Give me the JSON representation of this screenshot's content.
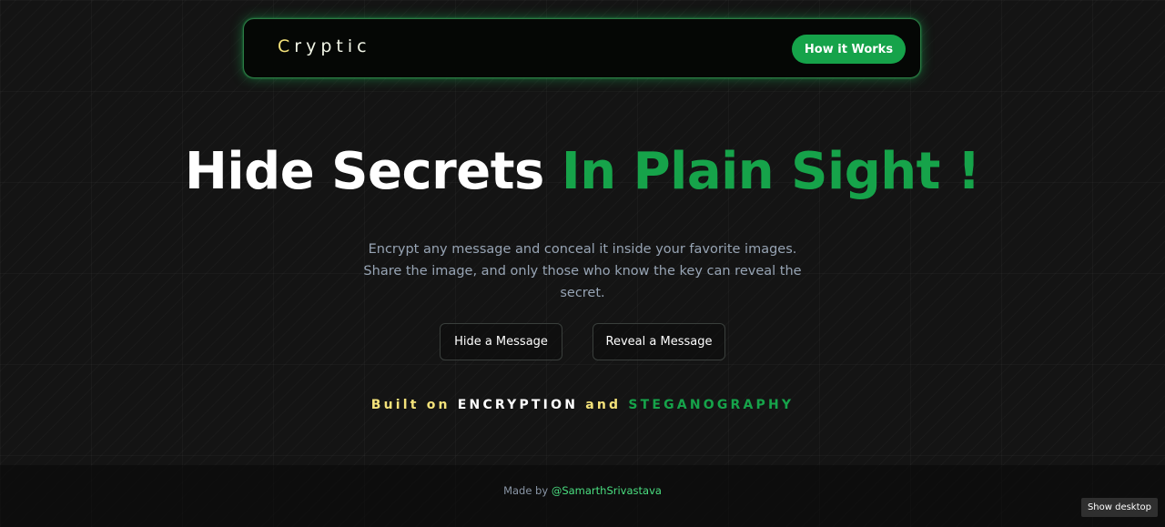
{
  "navbar": {
    "brand_first": "C",
    "brand_rest": "ryptic",
    "how_it_works_label": "How it Works"
  },
  "hero": {
    "headline_white": "Hide Secrets ",
    "headline_green": "In Plain Sight !",
    "subtitle": "Encrypt any message and conceal it inside your favorite images. Share the image, and only those who know the key can reveal the secret.",
    "hide_button_label": "Hide a Message",
    "reveal_button_label": "Reveal a Message"
  },
  "built_on": {
    "part1": "Built on ",
    "part2": "ENCRYPTION",
    "part3": " and ",
    "part4": "STEGANOGRAPHY"
  },
  "footer": {
    "made_by": "Made by ",
    "author_link": "@SamarthSrivastava"
  },
  "overlay": {
    "show_desktop_label": "Show desktop"
  },
  "colors": {
    "accent_green": "#16a34a",
    "accent_yellow": "#f4e27a",
    "background": "#141414"
  }
}
